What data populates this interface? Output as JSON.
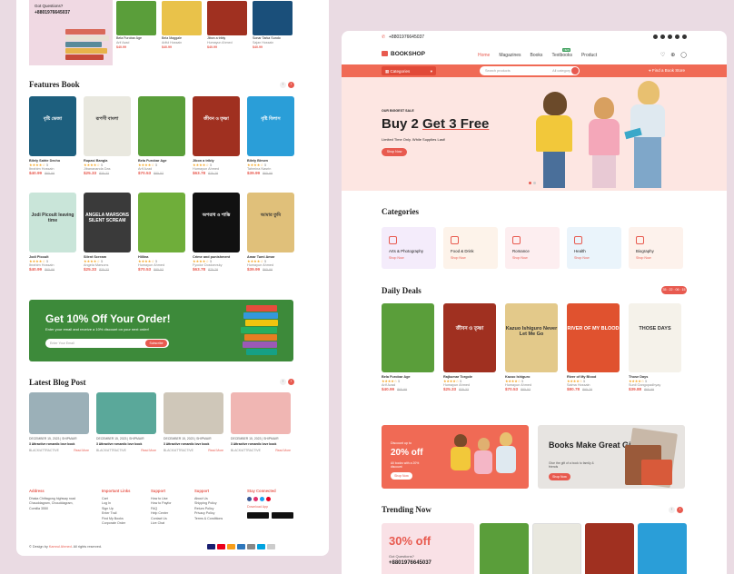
{
  "left": {
    "promo": {
      "q": "Got Questions?",
      "phone": "+8801976645037"
    },
    "top_cards": [
      {
        "title": "Bela Furobar Age",
        "author": "Arif Azad",
        "price": "$40.99",
        "old": "$65.99",
        "color": "#5a9e3a"
      },
      {
        "title": "Bela Maggale",
        "author": "Ariful Hossain",
        "price": "$40.99",
        "old": "$65.99",
        "color": "#e9c24a"
      },
      {
        "title": "Jibon a tribly",
        "author": "Humayun Ahmed",
        "price": "$40.99",
        "old": "$65.99",
        "color": "#a03020"
      },
      {
        "title": "Sonar Tarka Sundo",
        "author": "Sajan Hossain",
        "price": "$40.99",
        "old": "$65.99",
        "color": "#1a4f7a"
      }
    ],
    "features": {
      "title": "Features Book",
      "row1": [
        {
          "title": "Bilely Sahte Decho",
          "author": "Ibrahim Hossain",
          "price": "$40.99",
          "old": "$65.99",
          "color": "#1d5f7e",
          "cover": "বৃষ্টি ভেজা"
        },
        {
          "title": "Rupasi Bangla",
          "author": "Jibanananda Das",
          "price": "$25.33",
          "old": "$35.33",
          "color": "#e9e8df",
          "cover": "রূপসী বাংলা"
        },
        {
          "title": "Bela Furobar Age",
          "author": "Arif Azad",
          "price": "$70.53",
          "old": "$85.53",
          "color": "#5a9e3a",
          "cover": ""
        },
        {
          "title": "Jibon a tribly",
          "author": "Humayun Ahmed",
          "price": "$63.78",
          "old": "$75.78",
          "color": "#a03020",
          "cover": "জীবন ও তৃষ্ণা"
        },
        {
          "title": "Bilely Birsen",
          "author": "Tahmina Nasrin",
          "price": "$39.99",
          "old": "$65.99",
          "color": "#2a9ed8",
          "cover": "বৃষ্টি বিলাস"
        }
      ],
      "row2": [
        {
          "title": "Jodi Picoult",
          "author": "Ibrahim Hossain",
          "price": "$40.99",
          "old": "$65.99",
          "color": "#c9e5d9",
          "cover": "Jodi Picoult leaving time"
        },
        {
          "title": "Silent Scream",
          "author": "Angela Marsons",
          "price": "$25.33",
          "old": "$35.33",
          "color": "#3a3a3a",
          "cover": "ANGELA MARSONS SILENT SCREAM"
        },
        {
          "title": "Hillina",
          "author": "Humayun Ahmed",
          "price": "$70.53",
          "old": "$85.53",
          "color": "#6fae3a",
          "cover": ""
        },
        {
          "title": "Crime and punishment",
          "author": "Fyodor Dostoevsky",
          "price": "$63.78",
          "old": "$75.78",
          "color": "#111111",
          "cover": "অপরাধ ও শাস্তি"
        },
        {
          "title": "Amar Tumi Amar",
          "author": "Humayun Ahmed",
          "price": "$39.99",
          "old": "$65.99",
          "color": "#e0c07a",
          "cover": "আমার তুমি"
        }
      ]
    },
    "banner": {
      "title": "Get 10% Off Your Order!",
      "sub": "Enter your email and receive a 10% discount on your next order!",
      "placeholder": "Enter Your Email",
      "button": "Subscribe"
    },
    "blog": {
      "title": "Latest Blog Post",
      "posts": [
        {
          "date": "DECEMBER 15, 2023 | SHIPMAIR",
          "title": "3 Attractive romantic love book",
          "tag": "BLACK/ATTRACTIVE",
          "more": "Read More",
          "color": "#9bb0b8"
        },
        {
          "date": "DECEMBER 15, 2023 | SHIPMAIR",
          "title": "3 Attractive romantic love book",
          "tag": "BLACK/ATTRACTIVE",
          "more": "Read More",
          "color": "#5aa89a"
        },
        {
          "date": "DECEMBER 15, 2023 | SHIPMAIR",
          "title": "3 Attractive romantic love book",
          "tag": "BLACK/ATTRACTIVE",
          "more": "Read More",
          "color": "#cfc7b9"
        },
        {
          "date": "DECEMBER 15, 2023 | SHIPMAIR",
          "title": "3 Attractive romantic love book",
          "tag": "BLACK/ATTRACTIVE",
          "more": "Read More",
          "color": "#f0b6b3"
        }
      ]
    },
    "footer": {
      "address": {
        "title": "Address",
        "lines": [
          "Dhaka Chittagong highway road",
          "Chauddagram, Chouddagram,",
          "Comilla 3550"
        ]
      },
      "links": {
        "title": "Important Links",
        "lines": [
          "Cart",
          "Log In",
          "Sign Up",
          "Enter Trail",
          "Find My Books",
          "Corporate Order"
        ]
      },
      "support1": {
        "title": "Support",
        "lines": [
          "How to Use",
          "How to Payfor",
          "FAQ",
          "Help Center",
          "Contact Us",
          "Live Chat"
        ]
      },
      "support2": {
        "title": "Support",
        "lines": [
          "About Us",
          "Shipping Policy",
          "Return Policy",
          "Privacy Policy",
          "Terms & Conditions"
        ]
      },
      "connect": {
        "title": "Stay Connected",
        "app": "Download App"
      },
      "copy_pre": "© Design by",
      "copy_name": "Kamrul Ahmed",
      "copy_post": ". All rights reserved."
    }
  },
  "right": {
    "phone": "+8801976645037",
    "logo": "BOOKSHOP",
    "menu": [
      "Home",
      "Magazines",
      "Books",
      "Textbooks",
      "Product"
    ],
    "menu_badge": "NEW",
    "categories_btn": "Categories",
    "search_placeholder": "Search products",
    "search_scope": "All category",
    "store": "Find a Book Store",
    "hero": {
      "small": "OUR BIGGEST SALE",
      "title1": "Buy 2 ",
      "title2": "Get 3 Free",
      "sub": "Limited Time Only. While Supplies Last!",
      "button": "Shop Now"
    },
    "categories": {
      "title": "Categories",
      "items": [
        {
          "name": "Arts & Photography",
          "link": "Shop Now",
          "color": "#f4ecfb"
        },
        {
          "name": "Food & Drink",
          "link": "Shop Now",
          "color": "#fdf3ea"
        },
        {
          "name": "Romance",
          "link": "Shop Now",
          "color": "#fdeef0"
        },
        {
          "name": "Health",
          "link": "Shop Now",
          "color": "#eaf4fb"
        },
        {
          "name": "Biography",
          "link": "Shop Now",
          "color": "#fdf2ec"
        }
      ]
    },
    "deals": {
      "title": "Daily Deals",
      "timer": "35 : 22 : 06 : 15",
      "items": [
        {
          "title": "Bela Furobar Age",
          "author": "Arif Azad",
          "price": "$40.99",
          "old": "$65.99",
          "color": "#5a9e3a",
          "cover": ""
        },
        {
          "title": "Rajkumar Torgole",
          "author": "Humayun Ahmed",
          "price": "$25.33",
          "old": "$35.33",
          "color": "#a03020",
          "cover": "জীবন ও তৃষ্ণা"
        },
        {
          "title": "Kazuo Ishiguro",
          "author": "Humayun Ahmed",
          "price": "$70.53",
          "old": "$85.53",
          "color": "#e3c98a",
          "cover": "Kazuo Ishiguro Never Let Me Go"
        },
        {
          "title": "River of My Blood",
          "author": "Salma Hossain",
          "price": "$80.78",
          "old": "$95.78",
          "color": "#e0522f",
          "cover": "RIVER OF MY BLOOD"
        },
        {
          "title": "Those Days",
          "author": "Sunil Gangopadhyay",
          "price": "$39.88",
          "old": "$65.99",
          "color": "#f5f2ea",
          "cover": "THOSE DAYS"
        }
      ]
    },
    "promo1": {
      "small": "Discount up to",
      "big": "20% off",
      "sub": "All books with a 20% discount",
      "button": "Shop Now"
    },
    "promo2": {
      "title": "Books Make Great Gifts",
      "sub": "Give the gift of a book to family & friends",
      "button": "Shop Now"
    },
    "trending": {
      "title": "Trending Now",
      "big": "30% off",
      "q": "Got Questions?",
      "phone": "+8801976645037"
    }
  }
}
